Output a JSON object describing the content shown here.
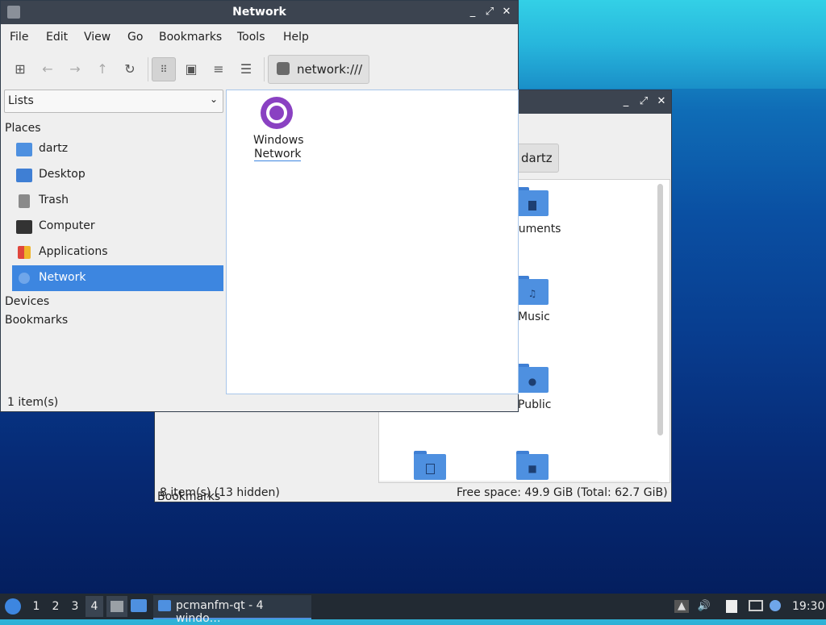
{
  "front_window": {
    "title": "Network",
    "menu": [
      "File",
      "Edit",
      "View",
      "Go",
      "Bookmarks",
      "Tools",
      "Help"
    ],
    "path": "network:///",
    "side_pane_mode": "Lists",
    "groups": {
      "places": "Places",
      "devices": "Devices",
      "bookmarks": "Bookmarks"
    },
    "places": [
      {
        "label": "dartz",
        "icon": "home-folder-icon"
      },
      {
        "label": "Desktop",
        "icon": "desktop-icon"
      },
      {
        "label": "Trash",
        "icon": "trash-icon"
      },
      {
        "label": "Computer",
        "icon": "computer-icon"
      },
      {
        "label": "Applications",
        "icon": "applications-icon"
      },
      {
        "label": "Network",
        "icon": "network-icon",
        "selected": true
      }
    ],
    "items": [
      {
        "label_line1": "Windows",
        "label_line2": "Network",
        "icon": "windows-network-icon"
      }
    ],
    "status": "1 item(s)"
  },
  "back_window": {
    "path_button": "dartz",
    "behind_text": "Bookmarks",
    "folders": [
      {
        "label": "cuments",
        "icon": "document-folder-icon"
      },
      {
        "label": "Music",
        "icon": "music-folder-icon"
      },
      {
        "label": "Public",
        "icon": "public-folder-icon"
      },
      {
        "label": "",
        "icon": "templates-folder-icon"
      },
      {
        "label": "",
        "icon": "videos-folder-icon"
      }
    ],
    "status_left": "8 item(s) (13 hidden)",
    "status_right": "Free space: 49.9 GiB (Total: 62.7 GiB)"
  },
  "taskbar": {
    "workspaces": [
      "1",
      "2",
      "3",
      "4"
    ],
    "active_workspace": "4",
    "task_label": "pcmanfm-qt - 4 windo…",
    "clock": "19:30"
  },
  "colors": {
    "accent": "#3d86e0",
    "titlebar": "#3c4450",
    "taskbar": "#222a33",
    "network_icon": "#8a41c2"
  }
}
